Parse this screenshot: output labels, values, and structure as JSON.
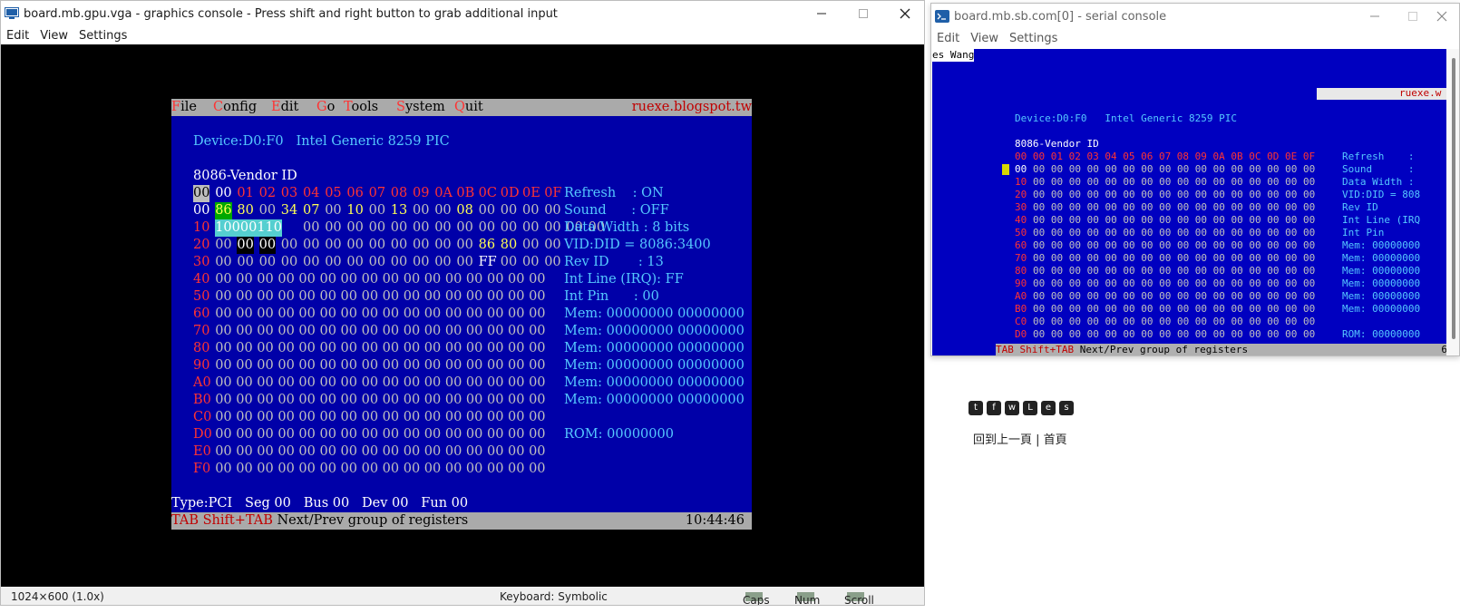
{
  "gfx": {
    "title": "board.mb.gpu.vga - graphics console - Press shift and right button to grab additional input",
    "menu": [
      "Edit",
      "View",
      "Settings"
    ],
    "status_res": "1024×600 (1.0x)",
    "status_keyboard": "Keyboard: Symbolic",
    "status_caps": "Caps",
    "status_num": "Num",
    "status_scroll": "Scroll"
  },
  "dos": {
    "menu": {
      "file": [
        "F",
        "ile"
      ],
      "config": [
        "C",
        "onfig"
      ],
      "edit": [
        "E",
        "dit"
      ],
      "go": [
        "G",
        "o"
      ],
      "tools": [
        "T",
        "ools"
      ],
      "system": [
        "S",
        "ystem"
      ],
      "quit": [
        "Q",
        "uit"
      ],
      "blog": "ruexe.blogspot.tw"
    },
    "device": "Device:D0:F0   Intel Generic 8259 PIC",
    "vendor": "8086-Vendor ID",
    "col_header": [
      "00",
      "00",
      "01",
      "02",
      "03",
      "04",
      "05",
      "06",
      "07",
      "08",
      "09",
      "0A",
      "0B",
      "0C",
      "0D",
      "0E",
      "0F"
    ],
    "rows": [
      {
        "label": "00",
        "cells": [
          "86",
          "80",
          "00",
          "34",
          "07",
          "00",
          "10",
          "00",
          "13",
          "00",
          "00",
          "08",
          "00",
          "00",
          "00",
          "00"
        ]
      },
      {
        "label": "10",
        "cells": [
          "10000110",
          "00",
          "00",
          "00",
          "00",
          "00",
          "00",
          "00",
          "00",
          "00",
          "00",
          "00",
          "00",
          "00",
          "00"
        ]
      },
      {
        "label": "20",
        "cells": [
          "00",
          "00",
          "00",
          "00",
          "00",
          "00",
          "00",
          "00",
          "00",
          "00",
          "00",
          "00",
          "86",
          "80",
          "00",
          "00"
        ]
      },
      {
        "label": "30",
        "cells": [
          "00",
          "00",
          "00",
          "00",
          "00",
          "00",
          "00",
          "00",
          "00",
          "00",
          "00",
          "00",
          "FF",
          "00",
          "00",
          "00"
        ]
      },
      {
        "label": "40"
      },
      {
        "label": "50"
      },
      {
        "label": "60"
      },
      {
        "label": "70"
      },
      {
        "label": "80"
      },
      {
        "label": "90"
      },
      {
        "label": "A0"
      },
      {
        "label": "B0"
      },
      {
        "label": "C0"
      },
      {
        "label": "D0"
      },
      {
        "label": "E0"
      },
      {
        "label": "F0"
      }
    ],
    "zero_row": "00 00 00 00 00 00 00 00 00 00 00 00 00 00 00 00",
    "info": [
      "Refresh    : ON",
      "Sound      : OFF",
      "Data Width : 8 bits",
      "VID:DID = 8086:3400",
      "Rev ID       : 13",
      "Int Line (IRQ): FF",
      "Int Pin      : 00",
      "Mem: 00000000 00000000",
      "Mem: 00000000 00000000",
      "Mem: 00000000 00000000",
      "Mem: 00000000 00000000",
      "Mem: 00000000 00000000",
      "Mem: 00000000 00000000",
      "",
      "ROM: 00000000"
    ],
    "type_line": "Type:PCI   Seg 00   Bus 00   Dev 00   Fun 00",
    "bottom_keys": "TAB Shift+TAB",
    "bottom_desc": " Next/Prev group of registers",
    "clock": "10:44:46"
  },
  "ser": {
    "title": "board.mb.sb.com[0] - serial console",
    "menu": [
      "Edit",
      "View",
      "Settings"
    ],
    "top_text": "es Wang",
    "blog": "ruexe.w",
    "device": "Device:D0:F0   Intel Generic 8259 PIC",
    "vendor": "8086-Vendor ID",
    "header": "00 00 01 02 03 04 05 06 07 08 09 0A 0B 0C 0D 0E 0F",
    "row_labels": [
      "00",
      "10",
      "20",
      "30",
      "40",
      "50",
      "60",
      "70",
      "80",
      "90",
      "A0",
      "B0",
      "C0",
      "D0"
    ],
    "info": [
      "Refresh    :",
      "Sound      :",
      "Data Width :",
      "VID:DID = 808",
      "Rev ID",
      "Int Line (IRQ",
      "Int Pin",
      "Mem: 00000000",
      "Mem: 00000000",
      "Mem: 00000000",
      "Mem: 00000000",
      "Mem: 00000000",
      "Mem: 00000000",
      "",
      "ROM: 00000000"
    ],
    "bottom_keys": "TAB Shift+TAB",
    "bottom_desc": " Next/Prev group of registers",
    "bottom_right": "6"
  },
  "blog": {
    "back": "回到上一頁",
    "sep": " | ",
    "home": "首頁"
  }
}
